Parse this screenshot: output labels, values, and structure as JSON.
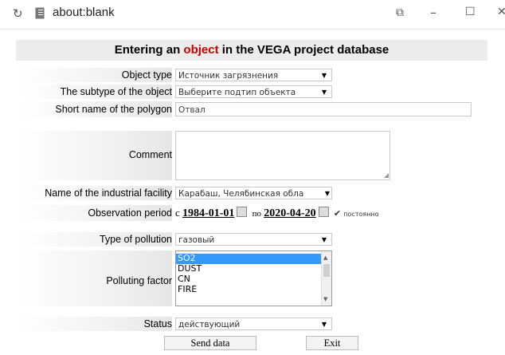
{
  "window": {
    "title": "about:blank",
    "refresh_icon": "refresh-icon",
    "page_icon": "page-icon",
    "buttons": {
      "restore": "restore-icon",
      "minimize": "minimize-icon",
      "maximize": "maximize-icon",
      "close": "close-icon"
    }
  },
  "form": {
    "title_before": "Entering an ",
    "title_accent": "object",
    "title_after": " in the VEGA project database",
    "accent_color": "#cc0000",
    "object_type": {
      "label": "Object type",
      "value": "Источник загрязнения"
    },
    "subtype": {
      "label": "The subtype of the object",
      "value": "Выберите подтип объекта"
    },
    "short_name": {
      "label": "Short name of the polygon",
      "value": "Отвал"
    },
    "comment": {
      "label": "Comment",
      "value": ""
    },
    "facility": {
      "label": "Name of the industrial facility",
      "value": "Карабаш, Челябинская обла"
    },
    "observation": {
      "label": "Observation period",
      "from_prefix": "с",
      "from_date": "1984-01-01",
      "to_prefix": "по",
      "to_date": "2020-04-20",
      "permanent_label": "постоянно"
    },
    "pollution_type": {
      "label": "Type of pollution",
      "value": "газовый"
    },
    "polluting_factor": {
      "label": "Polluting factor",
      "options": [
        "SO2",
        "DUST",
        "CN",
        "FIRE"
      ],
      "selected": "SO2"
    },
    "status": {
      "label": "Status",
      "value": "действующий"
    },
    "send_button": "Send data",
    "exit_button": "Exit"
  }
}
